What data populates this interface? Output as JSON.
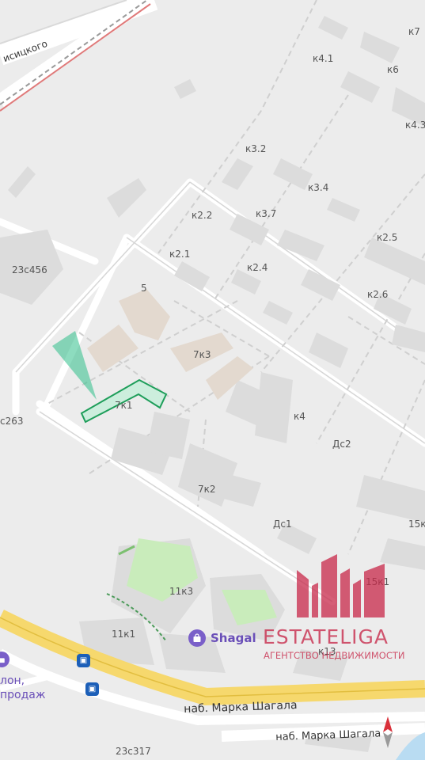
{
  "map": {
    "labels": {
      "k7": "к7",
      "k41": "к4.1",
      "k6": "к6",
      "k43": "к4.3",
      "k32": "к3.2",
      "k34": "к3.4",
      "k22": "к2.2",
      "k37": "к3.7",
      "k25": "к2.5",
      "k21": "к2.1",
      "k24": "к2.4",
      "k26": "к2.6",
      "c23s456": "23с456",
      "n5": "5",
      "k7k3": "7к3",
      "k7k1": "7к1",
      "k4": "к4",
      "s263": "с263",
      "ds2": "Дс2",
      "k7k2": "7к2",
      "ds1": "Дс1",
      "k15k": "15к",
      "k11k3": "11к3",
      "k15k1": "15к1",
      "k11k1": "11к1",
      "k13": "к13",
      "c23s317": "23с317"
    },
    "streets": {
      "top_partial": "исицкого",
      "embankment_main": "наб. Марка Шагала",
      "embankment_lower": "наб. Марка Шагала"
    },
    "poi": {
      "name": "Shagal",
      "icon": "shopping-bag-icon"
    },
    "left_poi": {
      "line1": "лон,",
      "line2": "продаж"
    },
    "transit_icon": "bus-stop-icon",
    "selected_building_color": "#1e9e5a",
    "view_cone_color": "#2fbf8a"
  },
  "watermark": {
    "name": "ESTATELIGA",
    "subtitle": "АГЕНТСТВО НЕДВИЖИМОСТИ",
    "color": "#c8294a"
  },
  "compass": {
    "icon": "compass-north-icon",
    "color": "#d9303a"
  }
}
